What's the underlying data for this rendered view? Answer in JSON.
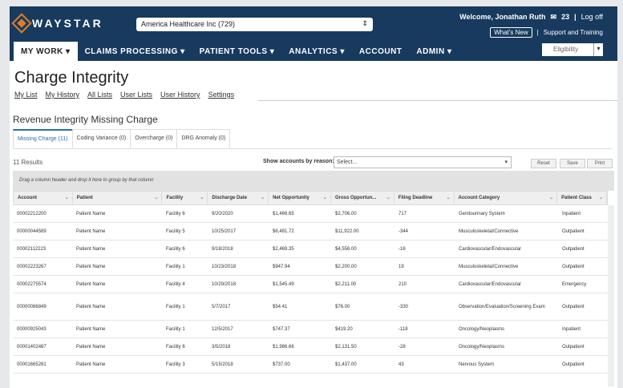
{
  "header": {
    "brand": "WAYSTAR",
    "org_select": "America Healthcare Inc (729)",
    "welcome": "Welcome, Jonathan Ruth",
    "mail_count": "23",
    "logoff": "Log off",
    "whats_new": "What's New",
    "support": "Support and Training",
    "eligibility": "Eligibility"
  },
  "nav": [
    "MY WORK ▾",
    "CLAIMS PROCESSING ▾",
    "PATIENT TOOLS ▾",
    "ANALYTICS ▾",
    "ACCOUNT",
    "ADMIN ▾"
  ],
  "page_title": "Charge Integrity",
  "subnav": [
    "My List",
    "My History",
    "All Lists",
    "User Lists",
    "User History",
    "Settings"
  ],
  "section_title": "Revenue Integrity Missing Charge",
  "tabs": [
    "Missing Charge (11)",
    "Coding Variance (0)",
    "Overcharge (0)",
    "DRG Anomaly (0)"
  ],
  "results": "11 Results",
  "reason_label": "Show accounts by reason:",
  "reason_select": "Select...",
  "buttons": {
    "reset": "Reset",
    "save": "Save",
    "print": "Print"
  },
  "group_hint": "Drag a column header and drop it here to group by that column",
  "columns": [
    "Account",
    "Patient",
    "Facility",
    "Discharge Date",
    "Net Opportunity",
    "Gross Opportun...",
    "Filing Deadline",
    "Account Category",
    "Patient Class"
  ],
  "rows": [
    [
      "00002212200",
      "Patient Name",
      "Facility 6",
      "9/20/2020",
      "$1,466.65",
      "$2,706.00",
      "717",
      "Genitourinary System",
      "Inpatient"
    ],
    [
      "00000044589",
      "Patient Name",
      "Facility 5",
      "10/25/2017",
      "$6,481.72",
      "$11,922.00",
      "-344",
      "Musculoskeletal/Connective",
      "Outpatient"
    ],
    [
      "00002112223",
      "Patient Name",
      "Facility 6",
      "9/18/2018",
      "$2,469.35",
      "$4,556.00",
      "-16",
      "Cardiovascular/Endovascular",
      "Outpatient"
    ],
    [
      "00002223267",
      "Patient Name",
      "Facility 1",
      "10/23/2018",
      "$947.94",
      "$2,200.00",
      "19",
      "Musculoskeletal/Connective",
      "Outpatient"
    ],
    [
      "00002275574",
      "Patient Name",
      "Facility 4",
      "10/29/2018",
      "$1,545.49",
      "$2,211.00",
      "210",
      "Cardiovascular/Endovascular",
      "Emergency"
    ],
    [
      "00000086849",
      "Patient Name",
      "Facility 1",
      "5/7/2017",
      "$54.41",
      "$76.00",
      "-330",
      "Observation/Evaluation/Screening Exam",
      "Outpatient"
    ],
    [
      "00000925043",
      "Patient Name",
      "Facility 1",
      "12/5/2017",
      "$747.37",
      "$419.20",
      "-118",
      "Oncology/Neoplasms",
      "Inpatient"
    ],
    [
      "00001402487",
      "Patient Name",
      "Facility 6",
      "3/5/2018",
      "$1,986.66",
      "$2,131.50",
      "-28",
      "Oncology/Neoplasms",
      "Outpatient"
    ],
    [
      "00001665281",
      "Patient Name",
      "Facility 3",
      "5/15/2018",
      "$737.00",
      "$1,437.00",
      "43",
      "Nervous System",
      "Outpatient"
    ]
  ]
}
